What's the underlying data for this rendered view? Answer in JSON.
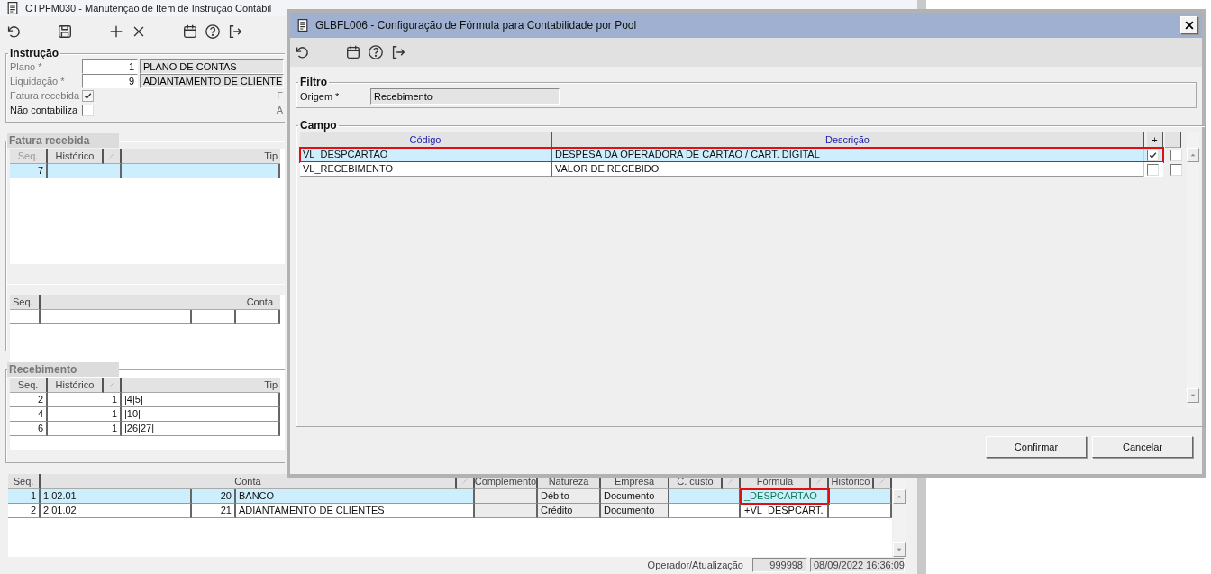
{
  "main_window": {
    "title": "CTPFM030 - Manutenção de Item de Instrução Contábil",
    "instrucao": {
      "title": "Instrução",
      "fields": [
        {
          "label": "Plano *",
          "value": "1",
          "description": "PLANO DE CONTAS"
        },
        {
          "label": "Liquidação *",
          "value": "9",
          "description": "ADIANTAMENTO DE CLIENTE"
        }
      ],
      "checkboxes": [
        {
          "label": "Fatura recebida",
          "checked": true,
          "disabled": true,
          "cut_label": "F"
        },
        {
          "label": "Não contabiliza",
          "checked": false,
          "disabled": false,
          "cut_label": "A"
        }
      ]
    },
    "fatura_recebida": {
      "title": "Fatura recebida",
      "columns": [
        "Seq.",
        "Histórico",
        "Tip"
      ],
      "rows": [
        {
          "seq": "7",
          "selected": true
        }
      ],
      "accounts_columns": [
        "Seq.",
        "Conta"
      ]
    },
    "recebimento": {
      "title": "Recebimento",
      "columns": [
        "Seq.",
        "Histórico",
        "Tip"
      ],
      "rows": [
        {
          "seq": "2",
          "historico": "1",
          "tipo": "|4|5|",
          "selected": false
        },
        {
          "seq": "4",
          "historico": "1",
          "tipo": "|10|",
          "selected": false
        },
        {
          "seq": "6",
          "historico": "1",
          "tipo": "|26|27|",
          "selected": false
        }
      ]
    },
    "lancamentos": {
      "columns": [
        "Seq.",
        "Conta",
        "Complemento",
        "Natureza",
        "Empresa",
        "C. custo",
        "Fórmula",
        "Histórico"
      ],
      "rows": [
        {
          "seq": "1",
          "conta": "1.02.01",
          "conta_num": "20",
          "conta_nome": "BANCO",
          "natureza": "Débito",
          "empresa": "Documento",
          "formula": "_DESPCARTAO",
          "formula_highlighted": true,
          "selected": true
        },
        {
          "seq": "2",
          "conta": "2.01.02",
          "conta_num": "21",
          "conta_nome": "ADIANTAMENTO DE CLIENTES",
          "natureza": "Crédito",
          "empresa": "Documento",
          "formula": "+VL_DESPCART.",
          "formula_highlighted": false,
          "selected": false
        }
      ]
    },
    "footer": {
      "label": "Operador/Atualização",
      "operator": "999998",
      "updated": "08/09/2022 16:36:09"
    }
  },
  "dialog": {
    "title": "GLBFL006 - Configuração de Fórmula para Contabilidade por Pool",
    "filtro": {
      "title": "Filtro",
      "label": "Origem *",
      "value": "Recebimento"
    },
    "campo": {
      "title": "Campo",
      "columns": [
        "Código",
        "Descrição",
        "+",
        "-"
      ],
      "rows": [
        {
          "codigo": "VL_DESPCARTAO",
          "descricao": "DESPESA DA OPERADORA DE CARTAO / CART. DIGITAL",
          "plus": true,
          "minus": false,
          "selected": true,
          "highlighted": true
        },
        {
          "codigo": "VL_RECEBIMENTO",
          "descricao": "VALOR DE RECEBIDO",
          "plus": false,
          "minus": false,
          "selected": false,
          "highlighted": false
        }
      ]
    },
    "buttons": [
      "Confirmar",
      "Cancelar"
    ]
  }
}
